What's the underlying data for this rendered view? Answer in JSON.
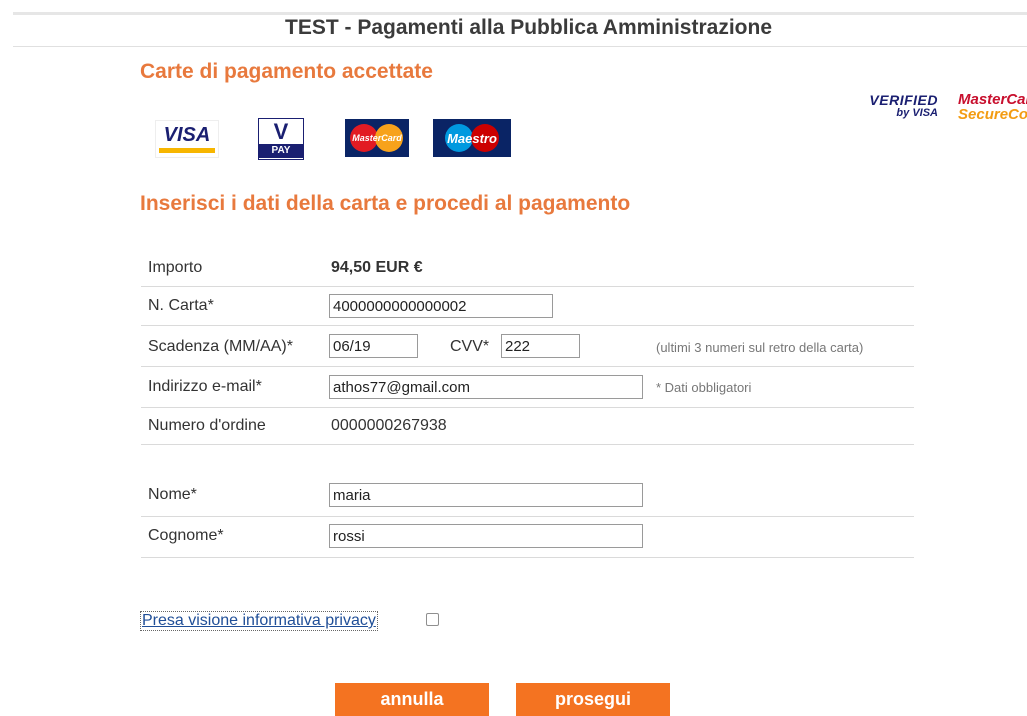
{
  "header": {
    "title": "TEST - Pagamenti alla Pubblica Amministrazione"
  },
  "cards_section": {
    "title": "Carte di pagamento accettate",
    "cards": [
      {
        "name": "VISA",
        "icon": "visa-logo"
      },
      {
        "name": "V",
        "sub": "PAY",
        "icon": "vpay-logo"
      },
      {
        "name": "MasterCard",
        "icon": "mastercard-logo"
      },
      {
        "name": "Maestro",
        "icon": "maestro-logo"
      }
    ],
    "secure_badges": {
      "verified_line1": "VERIFIED",
      "verified_line2": "by VISA",
      "mc_line1": "MasterCard",
      "mc_line2": "SecureCode"
    }
  },
  "form_section": {
    "title": "Inserisci i dati della carta e procedi al pagamento",
    "importo": {
      "label": "Importo",
      "value": "94,50 EUR €"
    },
    "card_number": {
      "label": "N. Carta*",
      "value": "4000000000000002"
    },
    "expiry": {
      "label": "Scadenza (MM/AA)*",
      "value": "06/19"
    },
    "cvv": {
      "label": "CVV*",
      "value": "222",
      "hint": "(ultimi 3 numeri sul retro della carta)"
    },
    "email": {
      "label": "Indirizzo e-mail*",
      "value": "athos77@gmail.com",
      "hint": "* Dati obbligatori"
    },
    "order": {
      "label": "Numero d'ordine",
      "value": "0000000267938"
    },
    "first_name": {
      "label": "Nome*",
      "value": "maria"
    },
    "last_name": {
      "label": "Cognome*",
      "value": "rossi"
    }
  },
  "privacy": {
    "link_text": "Presa visione informativa privacy",
    "checked": false
  },
  "buttons": {
    "cancel": "annulla",
    "proceed": "prosegui"
  },
  "colors": {
    "accent": "#e8793d",
    "button": "#f47321",
    "link": "#1f4e97"
  }
}
